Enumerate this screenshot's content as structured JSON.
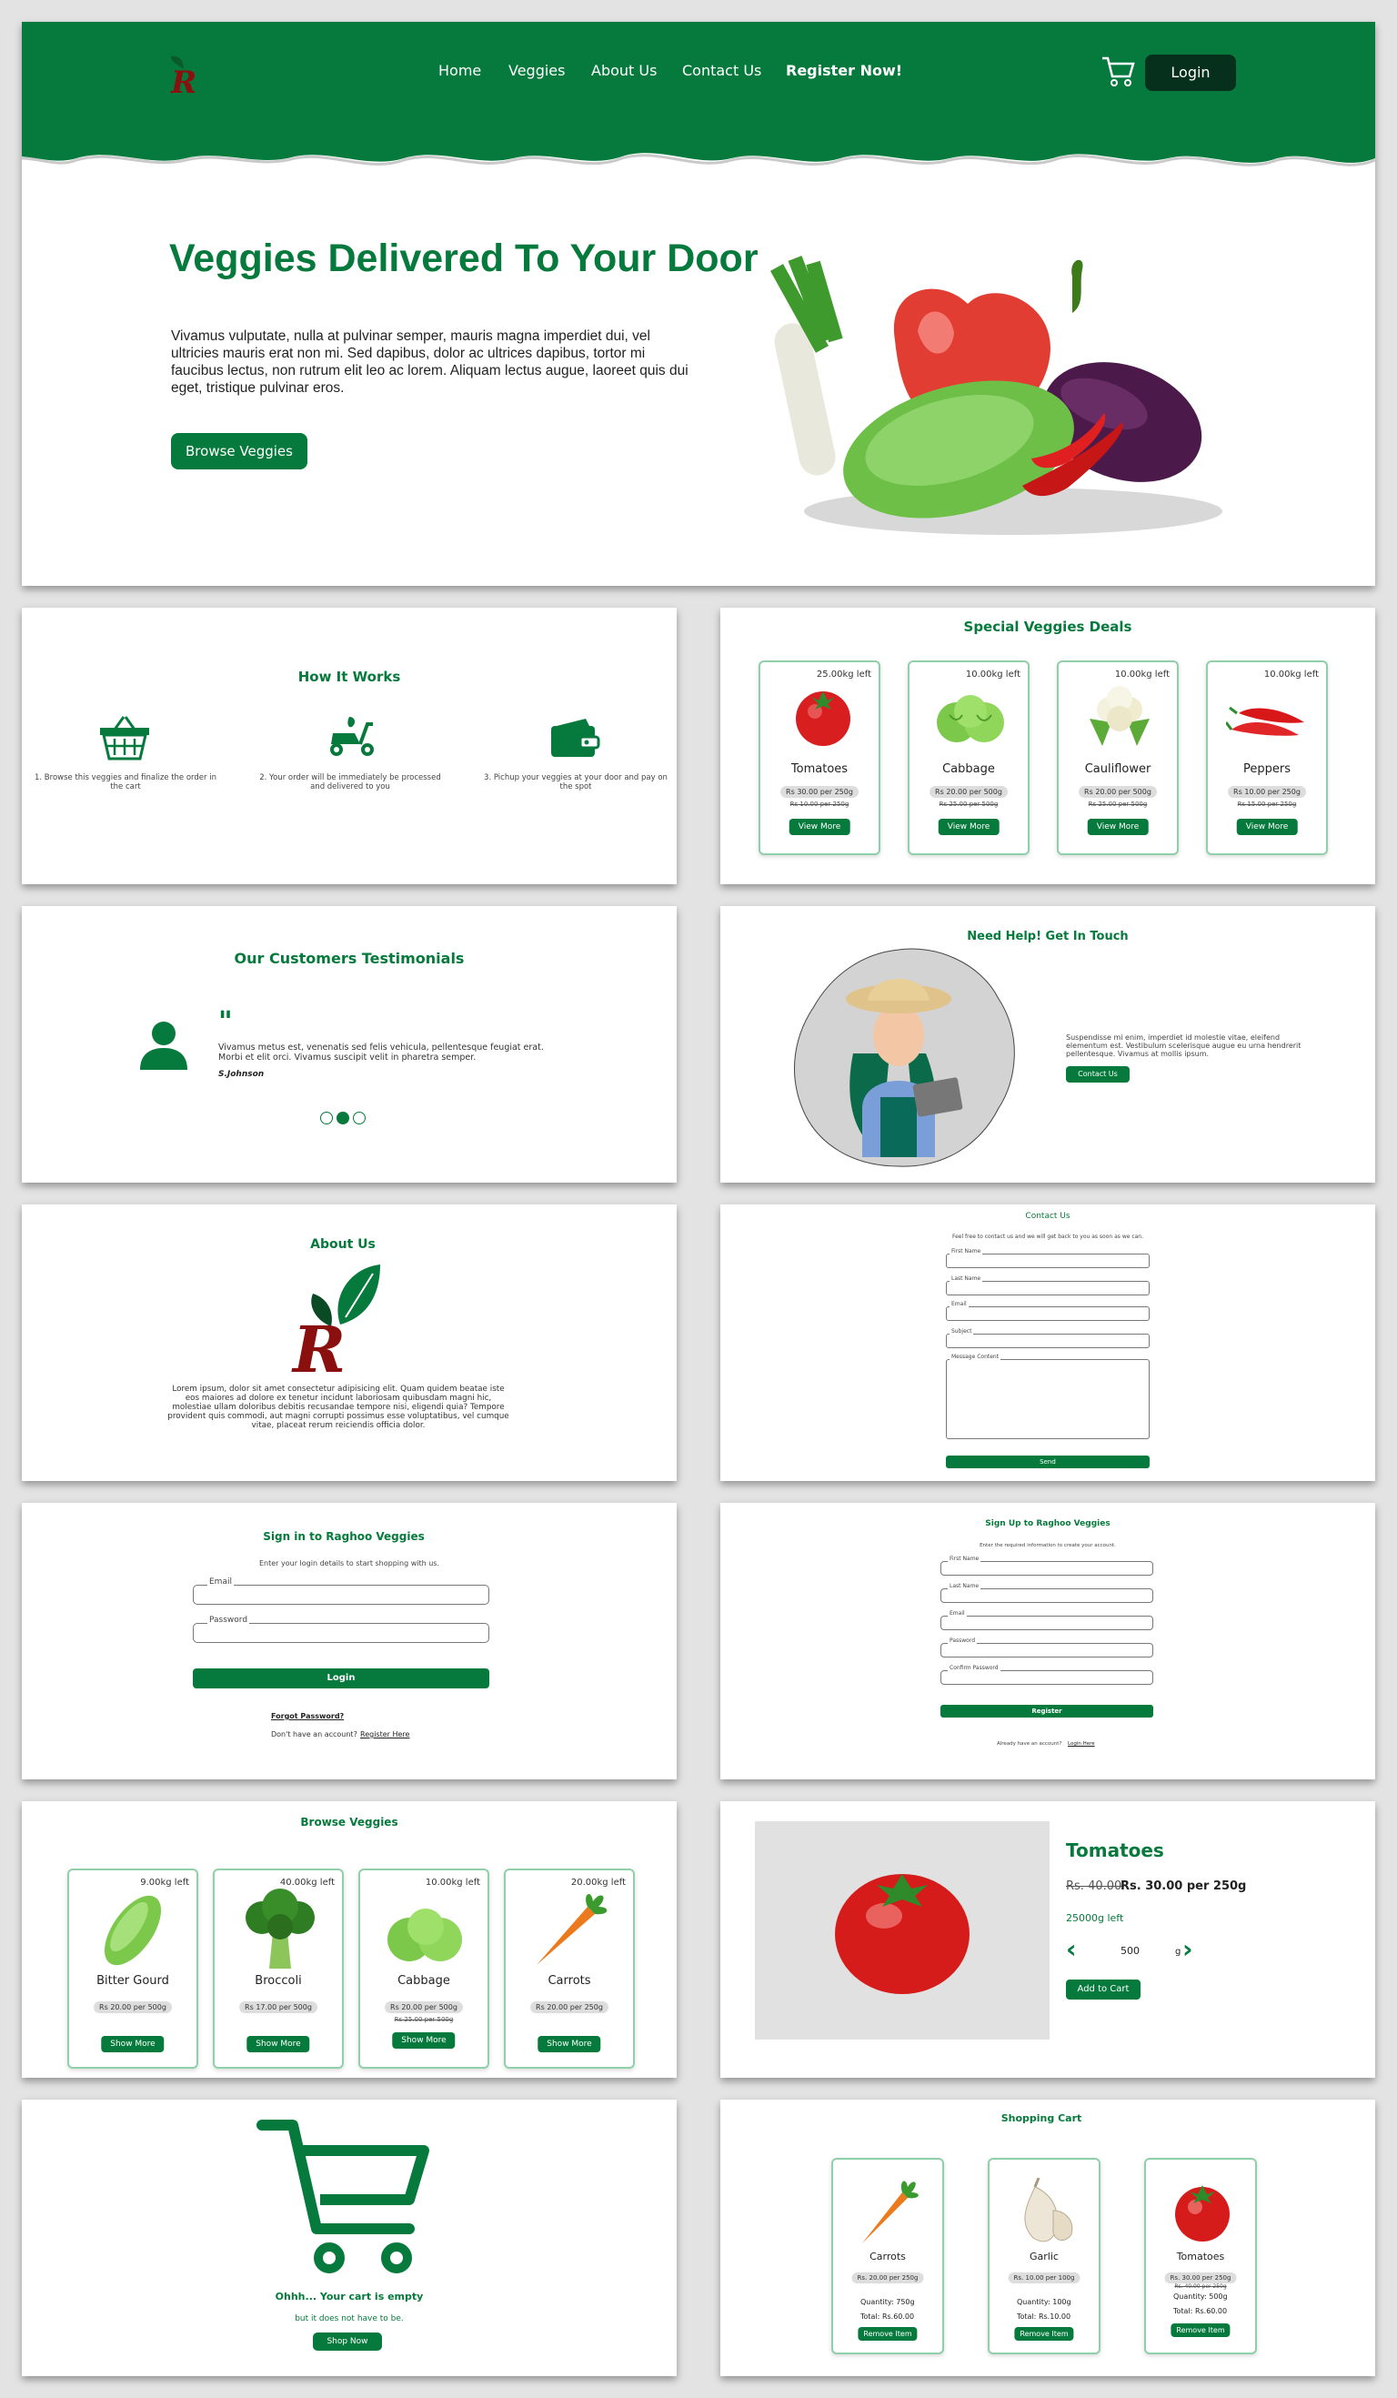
{
  "nav": {
    "home": "Home",
    "veggies": "Veggies",
    "about": "About Us",
    "contact": "Contact Us",
    "register": "Register Now!",
    "login": "Login"
  },
  "hero": {
    "title": "Veggies Delivered To Your Door",
    "body": "Vivamus vulputate, nulla at pulvinar semper, mauris magna imperdiet dui, vel ultricies mauris erat non mi. Sed dapibus, dolor ac ultrices dapibus, tortor mi faucibus lectus, non rutrum elit leo ac lorem. Aliquam lectus augue, laoreet quis dui eget, tristique pulvinar eros.",
    "button": "Browse Veggies"
  },
  "how": {
    "title": "How It Works",
    "steps": [
      {
        "icon": "basket-icon",
        "text": "1. Browse this veggies and finalize the order in the cart"
      },
      {
        "icon": "scooter-icon",
        "text": "2. Your order will be immediately be processed and delivered to you"
      },
      {
        "icon": "wallet-icon",
        "text": "3. Pichup your veggies at your door and pay on the spot"
      }
    ]
  },
  "deals": {
    "title": "Special Veggies Deals",
    "items": [
      {
        "name": "Tomatoes",
        "qty": "25.00kg left",
        "price": "Rs 30.00 per 250g",
        "old": "Rs 10.00 per 250g",
        "button": "View More",
        "icon": "tomato-icon"
      },
      {
        "name": "Cabbage",
        "qty": "10.00kg left",
        "price": "Rs 20.00 per 500g",
        "old": "Rs 25.00 per 500g",
        "button": "View More",
        "icon": "cabbage-icon"
      },
      {
        "name": "Cauliflower",
        "qty": "10.00kg left",
        "price": "Rs 20.00 per 500g",
        "old": "Rs 25.00 per 500g",
        "button": "View More",
        "icon": "cauliflower-icon"
      },
      {
        "name": "Peppers",
        "qty": "10.00kg left",
        "price": "Rs 10.00 per 250g",
        "old": "Rs 15.00 per 250g",
        "button": "View More",
        "icon": "pepper-icon"
      }
    ]
  },
  "testimonials": {
    "title": "Our Customers Testimonials",
    "quote": "Vivamus metus est, venenatis sed felis vehicula, pellentesque feugiat erat. Morbi et elit orci. Vivamus suscipit velit in pharetra semper.",
    "author": "S.Johnson"
  },
  "help": {
    "title": "Need Help! Get In Touch",
    "body": "Suspendisse mi enim, imperdiet id molestie vitae, eleifend elementum est. Vestibulum scelerisque augue eu urna hendrerit pellentesque. Vivamus at mollis ipsum.",
    "button": "Contact Us"
  },
  "about": {
    "title": "About Us",
    "body": "Lorem ipsum, dolor sit amet consectetur adipisicing elit. Quam quidem beatae iste eos maiores ad dolore ex tenetur incidunt laboriosam quibusdam magni hic, molestiae ullam doloribus debitis recusandae tempore nisi, eligendi quia? Tempore provident quis commodi, aut magni corrupti possimus esse voluptatibus, vel cumque vitae, placeat rerum reiciendis officia dolor."
  },
  "contact": {
    "title": "Contact Us",
    "intro": "Feel free to contact us and we will get back to you as soon as we can.",
    "first": "First Name",
    "last": "Last Name",
    "email": "Email",
    "subject": "Subject",
    "message": "Message Content",
    "send": "Send"
  },
  "signin": {
    "title": "Sign in to Raghoo Veggies",
    "intro": "Enter your login details to start shopping with us.",
    "email": "Email",
    "password": "Password",
    "button": "Login",
    "forgot": "Forgot Password?",
    "noacc": "Don't have an account?",
    "register": "Register Here"
  },
  "signup": {
    "title": "Sign Up to Raghoo Veggies",
    "intro": "Enter the required information to create your account.",
    "first": "First Name",
    "last": "Last Name",
    "email": "Email",
    "password": "Password",
    "confirm": "Confirm Password",
    "button": "Register",
    "already": "Already have an account?",
    "login": "Login Here"
  },
  "browse": {
    "title": "Browse Veggies",
    "items": [
      {
        "name": "Bitter Gourd",
        "qty": "9.00kg left",
        "price": "Rs 20.00 per 500g",
        "old": "",
        "button": "Show More",
        "icon": "bitter-gourd-icon"
      },
      {
        "name": "Broccoli",
        "qty": "40.00kg left",
        "price": "Rs 17.00 per 500g",
        "old": "",
        "button": "Show More",
        "icon": "broccoli-icon"
      },
      {
        "name": "Cabbage",
        "qty": "10.00kg left",
        "price": "Rs 20.00 per 500g",
        "old": "Rs 25.00 per 500g",
        "button": "Show More",
        "icon": "cabbage-icon"
      },
      {
        "name": "Carrots",
        "qty": "20.00kg left",
        "price": "Rs 20.00 per 250g",
        "old": "",
        "button": "Show More",
        "icon": "carrot-icon"
      }
    ]
  },
  "product": {
    "name": "Tomatoes",
    "old": "Rs. 40.00",
    "price": "Rs. 30.00 per 250g",
    "stock": "25000g left",
    "quantity": "500",
    "unit": "g",
    "button": "Add to Cart"
  },
  "empty": {
    "title": "Ohhh... Your cart is empty",
    "sub": "but it does not have to be.",
    "button": "Shop Now"
  },
  "cart": {
    "title": "Shopping Cart",
    "qlabel": "Quantity:",
    "tlabel": "Total:",
    "items": [
      {
        "name": "Carrots",
        "price": "Rs. 20.00 per 250g",
        "old": "",
        "quantity": "750g",
        "total": "Rs.60.00",
        "button": "Remove Item",
        "icon": "carrot-icon"
      },
      {
        "name": "Garlic",
        "price": "Rs. 10.00 per 100g",
        "old": "",
        "quantity": "100g",
        "total": "Rs.10.00",
        "button": "Remove Item",
        "icon": "garlic-icon"
      },
      {
        "name": "Tomatoes",
        "price": "Rs. 30.00 per 250g",
        "old": "Rs. 40.00 per 250g",
        "quantity": "500g",
        "total": "Rs.60.00",
        "button": "Remove Item",
        "icon": "tomato-icon"
      }
    ]
  },
  "colors": {
    "brand": "#067a3c",
    "dark": "#06301c"
  }
}
